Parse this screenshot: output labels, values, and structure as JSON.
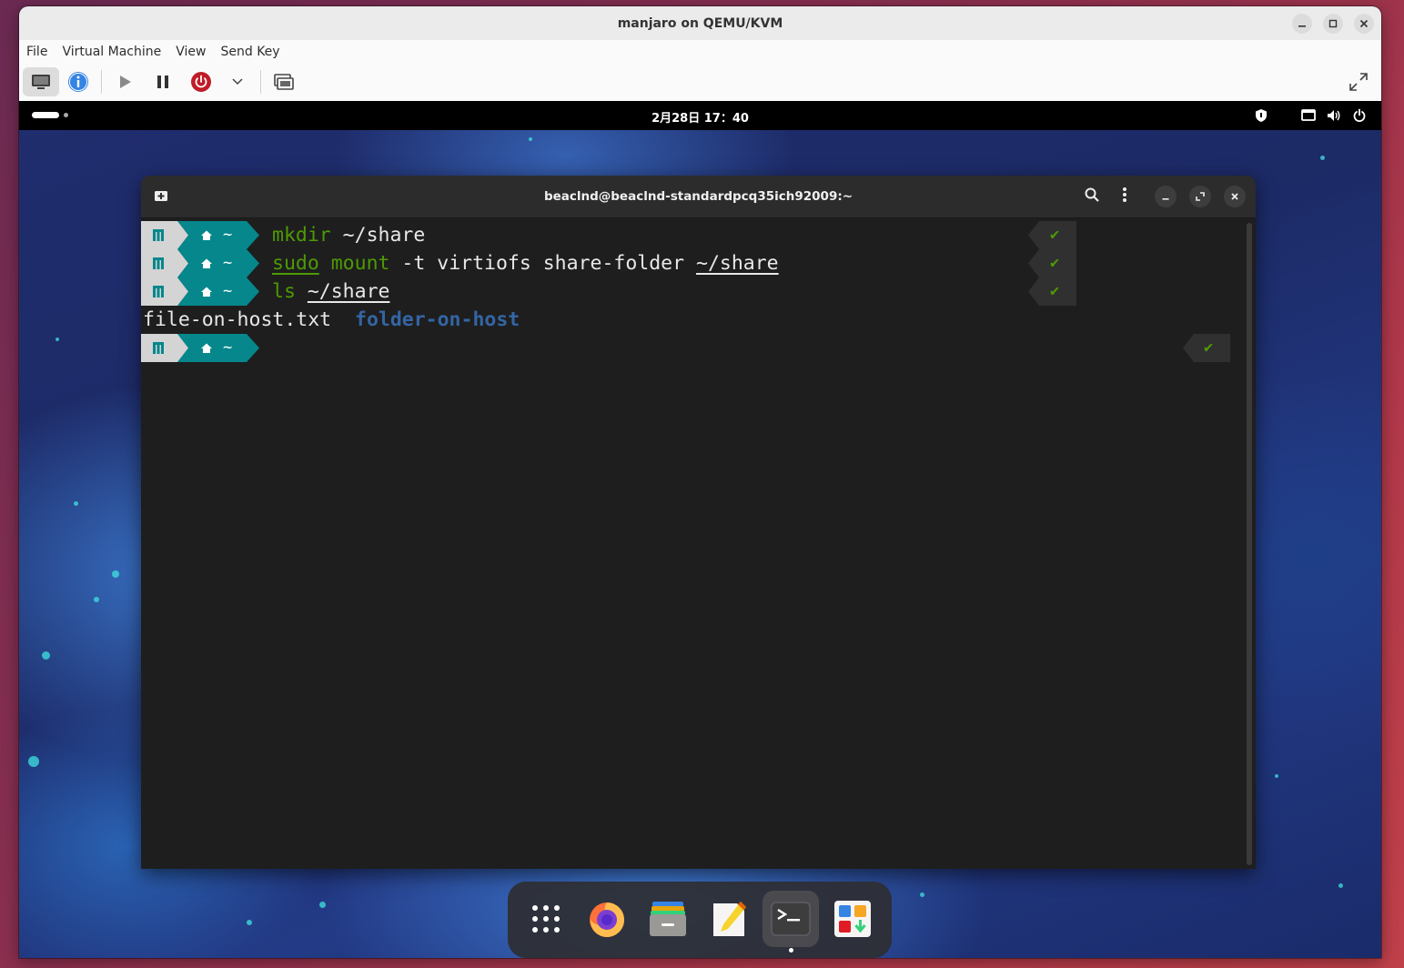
{
  "host": {
    "title": "manjaro on QEMU/KVM",
    "menus": [
      "File",
      "Virtual Machine",
      "View",
      "Send Key"
    ]
  },
  "guest": {
    "clock": "2月28日  17：40",
    "terminal": {
      "title": "beaclnd@beaclnd-standardpcq35ich92009:~",
      "prompt_dir": "~",
      "lines": [
        {
          "cmd": "mkdir",
          "rest": " ~/share",
          "status": "✔"
        },
        {
          "sudo": "sudo",
          "cmd": "mount",
          "rest": " -t virtiofs share-folder ",
          "path": "~/share",
          "status": "✔"
        },
        {
          "cmd": "ls",
          "path": "~/share",
          "status": "✔"
        }
      ],
      "output": {
        "file": "file-on-host.txt",
        "folder": "folder-on-host"
      },
      "final_status": "✔"
    }
  },
  "colors": {
    "prompt_teal": "#05878c",
    "prompt_gray": "#d4d4d4",
    "command_green": "#4e9a06",
    "folder_blue": "#3465a4"
  }
}
